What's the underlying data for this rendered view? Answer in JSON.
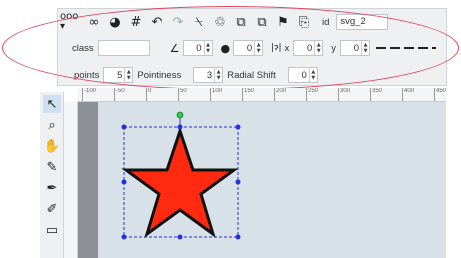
{
  "toolbar": {
    "tools": [
      {
        "name": "more-tools-icon",
        "glyph": "ooo ▾"
      },
      {
        "name": "link-icon",
        "glyph": "∞"
      },
      {
        "name": "color-fill-icon",
        "glyph": "◕"
      },
      {
        "name": "grid-icon",
        "glyph": "#"
      },
      {
        "name": "undo-icon",
        "glyph": "↶"
      },
      {
        "name": "redo-icon",
        "glyph": "↷"
      },
      {
        "name": "stamp-icon",
        "glyph": "⍀"
      },
      {
        "name": "trash-icon",
        "glyph": "♲"
      },
      {
        "name": "clone-icon",
        "glyph": "⧉"
      },
      {
        "name": "duplicate-icon",
        "glyph": "⧉"
      },
      {
        "name": "move-to-layer-icon",
        "glyph": "⚑"
      },
      {
        "name": "eraser-icon",
        "glyph": "⎘"
      }
    ],
    "id_label": "id",
    "id_value": "svg_2",
    "class_label": "class",
    "class_value": "",
    "rotation_icon": "∠",
    "rotation_value": "0",
    "blur_icon": "●",
    "blur_value": "0",
    "x_icon": "|ɂ|",
    "x_label": "x",
    "x_value": "0",
    "y_label": "y",
    "y_value": "0",
    "points_label": "points",
    "points_value": "5",
    "pointiness_label": "Pointiness",
    "pointiness_value": "3",
    "radial_shift_label": "Radial Shift",
    "radial_shift_value": "0"
  },
  "ruler": {
    "ticks": [
      "-100",
      "-50",
      "0",
      "50",
      "100",
      "150",
      "200",
      "250",
      "300",
      "350",
      "400",
      "450"
    ]
  },
  "left_tools": [
    {
      "name": "select-arrow-icon",
      "glyph": "↖"
    },
    {
      "name": "zoom-icon",
      "glyph": "⌕"
    },
    {
      "name": "pan-hand-icon",
      "glyph": "✋"
    },
    {
      "name": "pencil-icon",
      "glyph": "✎"
    },
    {
      "name": "pen-icon",
      "glyph": "✒"
    },
    {
      "name": "path-icon",
      "glyph": "✐"
    },
    {
      "name": "rectangle-icon",
      "glyph": "▭"
    }
  ],
  "colors": {
    "star_fill": "#ff2a10",
    "selection": "#2233dd",
    "rotate_handle": "#2ecc4a",
    "highlight": "#e2445c"
  }
}
